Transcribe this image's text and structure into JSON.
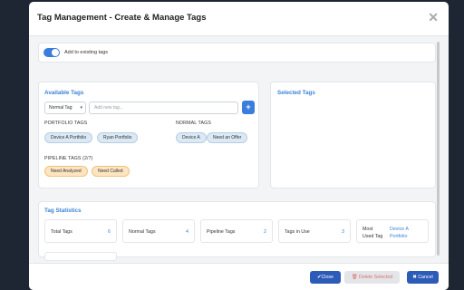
{
  "modal": {
    "title": "Tag Management - Create & Manage Tags",
    "close_icon": "close-icon"
  },
  "toggle": {
    "label": "Add to existing tags",
    "on": true
  },
  "available": {
    "title": "Available Tags",
    "tag_type": "Normal Tag",
    "input_placeholder": "Add new tag...",
    "add_label": "+",
    "portfolio": {
      "label": "PORTFOLIO TAGS",
      "chips": [
        "Device A Portfolio",
        "Ryan Portfolio"
      ]
    },
    "normal": {
      "label": "NORMAL TAGS",
      "chips": [
        "Device A",
        "Need an Offer"
      ]
    },
    "pipeline": {
      "label": "PIPELINE TAGS (2/7)",
      "chips": [
        "Need Analyzed",
        "Need Called"
      ]
    }
  },
  "selected": {
    "title": "Selected Tags"
  },
  "stats": {
    "title": "Tag Statistics",
    "items": [
      {
        "name": "Total Tags",
        "value": "6"
      },
      {
        "name": "Normal Tags",
        "value": "4"
      },
      {
        "name": "Pipeline Tags",
        "value": "2"
      },
      {
        "name": "Tags in Use",
        "value": "3"
      },
      {
        "name": "Most Used Tag",
        "value": "Device A Portfolio"
      }
    ]
  },
  "footer": {
    "close": "✔Close",
    "delete": "🗑 Delete Selected",
    "cancel": "✖ Cancel"
  },
  "colors": {
    "accent": "#3b7ddd",
    "footer_primary": "#2c5bb8",
    "chip_blue": "#dbe9f5",
    "chip_orange": "#fde5c2"
  }
}
